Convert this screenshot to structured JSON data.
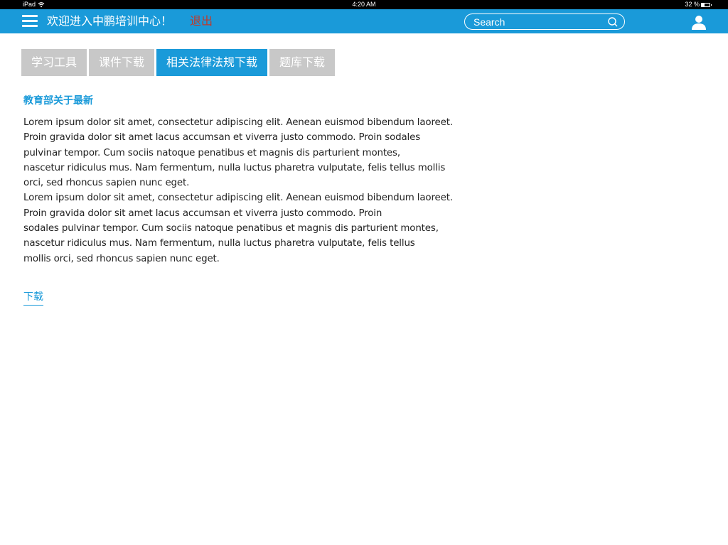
{
  "status_bar": {
    "device": "iPad",
    "time": "4:20 AM",
    "battery_percent": "32 %",
    "battery_level": 0.32,
    "wifi_icon": "wifi-icon",
    "battery_icon": "battery-icon"
  },
  "header": {
    "background_color": "#1a9ad9",
    "menu_icon": "hamburger-menu-icon",
    "welcome": "欢迎进入中鹏培训中心！",
    "logout": "退出",
    "logout_color": "#c0392b",
    "search": {
      "placeholder": "Search",
      "value": "",
      "icon": "search-icon"
    },
    "user_icon": "user-icon"
  },
  "tabs": [
    {
      "label": "学习工具",
      "active": false
    },
    {
      "label": "课件下载",
      "active": false
    },
    {
      "label": "相关法律法规下载",
      "active": true
    },
    {
      "label": "题库下载",
      "active": false
    }
  ],
  "colors": {
    "accent": "#1a9ad9",
    "tab_inactive": "#c8c8c8",
    "body_text": "#222222"
  },
  "article": {
    "title": "教育部关于最新",
    "lines": [
      "Lorem ipsum dolor sit amet, consectetur adipiscing elit. Aenean euismod bibendum laoreet.",
      "Proin gravida dolor sit amet lacus accumsan et viverra justo commodo. Proin sodales",
      "pulvinar tempor. Cum sociis natoque penatibus et magnis dis parturient montes,",
      "nascetur ridiculus mus. Nam fermentum, nulla luctus pharetra vulputate, felis tellus mollis",
      "orci, sed rhoncus sapien nunc eget.",
      "Lorem ipsum dolor sit amet, consectetur adipiscing elit. Aenean euismod bibendum laoreet.",
      "Proin gravida dolor sit amet lacus accumsan et viverra justo commodo. Proin",
      "sodales pulvinar tempor. Cum sociis natoque penatibus et magnis dis parturient montes,",
      "nascetur ridiculus mus. Nam fermentum, nulla luctus pharetra vulputate, felis tellus",
      "mollis orci, sed rhoncus sapien nunc eget."
    ],
    "download_label": "下载"
  }
}
